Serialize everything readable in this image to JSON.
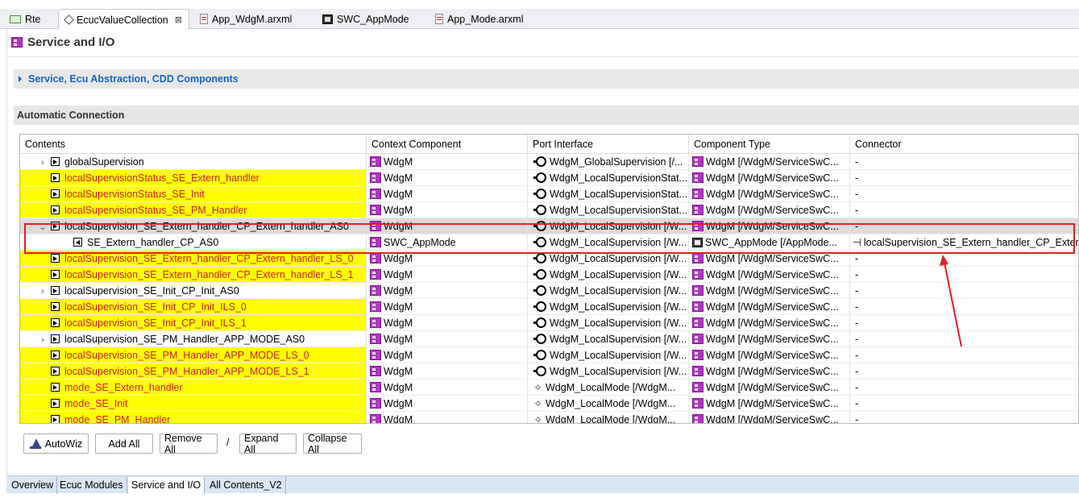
{
  "editor_tabs": [
    {
      "label": "Rte",
      "icon": "rte-icon"
    },
    {
      "label": "EcucValueCollection",
      "icon": "diamond-icon",
      "close": "⊠"
    },
    {
      "label": "App_WdgM.arxml",
      "icon": "arxml-file-icon"
    },
    {
      "label": "SWC_AppMode",
      "icon": "swc-icon"
    },
    {
      "label": "App_Mode.arxml",
      "icon": "arxml-file-icon"
    }
  ],
  "page": {
    "title": "Service and I/O",
    "collapsed_section": "Service, Ecu Abstraction, CDD Components",
    "auto_section": "Automatic Connection"
  },
  "table": {
    "headers": [
      "Contents",
      "Context Component",
      "Port Interface",
      "Component Type",
      "Connector"
    ],
    "rows": [
      {
        "indent": 1,
        "toggle": "›",
        "box": "right",
        "name": "globalSupervision",
        "highlight": false,
        "ctx": "WdgM",
        "port_icon": "port",
        "port": "WdgM_GlobalSupervision [/...",
        "ctype_icon": "comp",
        "ctype": "WdgM [/WdgM/ServiceSwC...",
        "conn": "-"
      },
      {
        "indent": 1,
        "toggle": "",
        "box": "right",
        "name": "localSupervisionStatus_SE_Extern_handler",
        "highlight": true,
        "ctx": "WdgM",
        "port_icon": "port",
        "port": "WdgM_LocalSupervisionStat...",
        "ctype_icon": "comp",
        "ctype": "WdgM [/WdgM/ServiceSwC...",
        "conn": "-"
      },
      {
        "indent": 1,
        "toggle": "",
        "box": "right",
        "name": "localSupervisionStatus_SE_Init",
        "highlight": true,
        "ctx": "WdgM",
        "port_icon": "port",
        "port": "WdgM_LocalSupervisionStat...",
        "ctype_icon": "comp",
        "ctype": "WdgM [/WdgM/ServiceSwC...",
        "conn": "-"
      },
      {
        "indent": 1,
        "toggle": "",
        "box": "right",
        "name": "localSupervisionStatus_SE_PM_Handler",
        "highlight": true,
        "ctx": "WdgM",
        "port_icon": "port",
        "port": "WdgM_LocalSupervisionStat...",
        "ctype_icon": "comp",
        "ctype": "WdgM [/WdgM/ServiceSwC...",
        "conn": "-"
      },
      {
        "indent": 1,
        "toggle": "⌄",
        "box": "right",
        "name": "localSupervision_SE_Extern_handler_CP_Extern_handler_AS0",
        "highlight": false,
        "selected": true,
        "ctx": "WdgM",
        "port_icon": "port",
        "port": "WdgM_LocalSupervision [/W...",
        "ctype_icon": "comp",
        "ctype": "WdgM [/WdgM/ServiceSwC...",
        "conn": "-"
      },
      {
        "indent": 2,
        "toggle": "",
        "box": "left",
        "name": "SE_Extern_handler_CP_AS0",
        "highlight": false,
        "ctx": "SWC_AppMode",
        "port_icon": "port",
        "port": "WdgM_LocalSupervision [/W...",
        "ctype_icon": "appl",
        "ctype": "SWC_AppMode [/AppMode...",
        "conn": "localSupervision_SE_Extern_handler_CP_Extern",
        "conn_icon": true
      },
      {
        "indent": 1,
        "toggle": "",
        "box": "right",
        "name": "localSupervision_SE_Extern_handler_CP_Extern_handler_LS_0",
        "highlight": true,
        "ctx": "WdgM",
        "port_icon": "port",
        "port": "WdgM_LocalSupervision [/W...",
        "ctype_icon": "comp",
        "ctype": "WdgM [/WdgM/ServiceSwC...",
        "conn": "-"
      },
      {
        "indent": 1,
        "toggle": "",
        "box": "right",
        "name": "localSupervision_SE_Extern_handler_CP_Extern_handler_LS_1",
        "highlight": true,
        "ctx": "WdgM",
        "port_icon": "port",
        "port": "WdgM_LocalSupervision [/W...",
        "ctype_icon": "comp",
        "ctype": "WdgM [/WdgM/ServiceSwC...",
        "conn": "-"
      },
      {
        "indent": 1,
        "toggle": "›",
        "box": "right",
        "name": "localSupervision_SE_Init_CP_Init_AS0",
        "highlight": false,
        "ctx": "WdgM",
        "port_icon": "port",
        "port": "WdgM_LocalSupervision [/W...",
        "ctype_icon": "comp",
        "ctype": "WdgM [/WdgM/ServiceSwC...",
        "conn": "-"
      },
      {
        "indent": 1,
        "toggle": "",
        "box": "right",
        "name": "localSupervision_SE_Init_CP_Init_ILS_0",
        "highlight": true,
        "ctx": "WdgM",
        "port_icon": "port",
        "port": "WdgM_LocalSupervision [/W...",
        "ctype_icon": "comp",
        "ctype": "WdgM [/WdgM/ServiceSwC...",
        "conn": "-"
      },
      {
        "indent": 1,
        "toggle": "",
        "box": "right",
        "name": "localSupervision_SE_Init_CP_Init_ILS_1",
        "highlight": true,
        "ctx": "WdgM",
        "port_icon": "port",
        "port": "WdgM_LocalSupervision [/W...",
        "ctype_icon": "comp",
        "ctype": "WdgM [/WdgM/ServiceSwC...",
        "conn": "-"
      },
      {
        "indent": 1,
        "toggle": "›",
        "box": "right",
        "name": "localSupervision_SE_PM_Handler_APP_MODE_AS0",
        "highlight": false,
        "ctx": "WdgM",
        "port_icon": "port",
        "port": "WdgM_LocalSupervision [/W...",
        "ctype_icon": "comp",
        "ctype": "WdgM [/WdgM/ServiceSwC...",
        "conn": "-"
      },
      {
        "indent": 1,
        "toggle": "",
        "box": "right",
        "name": "localSupervision_SE_PM_Handler_APP_MODE_LS_0",
        "highlight": true,
        "ctx": "WdgM",
        "port_icon": "port",
        "port": "WdgM_LocalSupervision [/W...",
        "ctype_icon": "comp",
        "ctype": "WdgM [/WdgM/ServiceSwC...",
        "conn": "-"
      },
      {
        "indent": 1,
        "toggle": "",
        "box": "right",
        "name": "localSupervision_SE_PM_Handler_APP_MODE_LS_1",
        "highlight": true,
        "ctx": "WdgM",
        "port_icon": "port",
        "port": "WdgM_LocalSupervision [/W...",
        "ctype_icon": "comp",
        "ctype": "WdgM [/WdgM/ServiceSwC...",
        "conn": "-"
      },
      {
        "indent": 1,
        "toggle": "",
        "box": "right",
        "name": "mode_SE_Extern_handler",
        "highlight": true,
        "ctx": "WdgM",
        "port_icon": "mode",
        "port": "WdgM_LocalMode [/WdgM...",
        "ctype_icon": "comp",
        "ctype": "WdgM [/WdgM/ServiceSwC...",
        "conn": "-"
      },
      {
        "indent": 1,
        "toggle": "",
        "box": "right",
        "name": "mode_SE_Init",
        "highlight": true,
        "ctx": "WdgM",
        "port_icon": "mode",
        "port": "WdgM_LocalMode [/WdgM...",
        "ctype_icon": "comp",
        "ctype": "WdgM [/WdgM/ServiceSwC...",
        "conn": "-"
      },
      {
        "indent": 1,
        "toggle": "",
        "box": "right",
        "name": "mode_SE_PM_Handler",
        "highlight": true,
        "ctx": "WdgM",
        "port_icon": "mode",
        "port": "WdgM_LocalMode [/WdgM...",
        "ctype_icon": "comp",
        "ctype": "WdgM [/WdgM/ServiceSwC...",
        "conn": "-"
      }
    ]
  },
  "buttons": {
    "autowiz": "AutoWiz",
    "add_all": "Add All",
    "remove_all": "Remove All",
    "separator": "/",
    "expand_all": "Expand All",
    "collapse_all": "Collapse All"
  },
  "bottom_tabs": [
    "Overview",
    "Ecuc Modules",
    "Service and I/O",
    "All Contents_V2"
  ],
  "bottom_active": "Service and I/O",
  "colors": {
    "highlight": "#ffff00",
    "highlight_text": "#d02020",
    "annotation": "#e02020",
    "link": "#1464c0"
  }
}
